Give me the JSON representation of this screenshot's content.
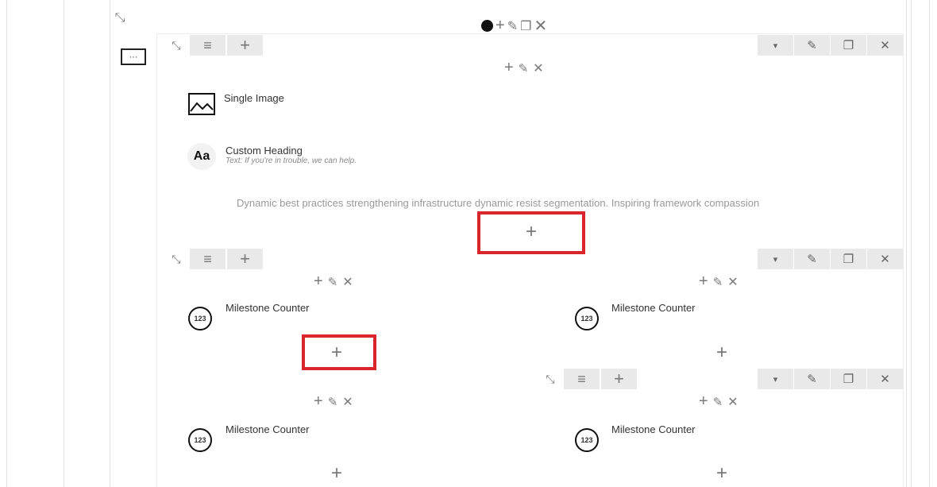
{
  "top_controls": {
    "add": "+",
    "edit": "✎",
    "clone": "❐",
    "delete": "✕"
  },
  "row_ctrl_glyphs": {
    "expand": "⤡",
    "drag": "≡",
    "add": "+",
    "dropdown": "▾",
    "edit": "✎",
    "clone": "❐",
    "delete": "✕"
  },
  "more_button": "···",
  "row1": {
    "column_controls": {
      "add": "+",
      "edit": "✎",
      "delete": "✕"
    },
    "elements": [
      {
        "title": "Single Image",
        "icon": "image-icon"
      },
      {
        "title": "Custom Heading",
        "subtitle": "Text: If you're in trouble, we can help.",
        "icon": "heading-icon",
        "icon_text": "Aa"
      }
    ],
    "text_block": "Dynamic best practices strengthening infrastructure dynamic resist segmentation. Inspiring framework compassion",
    "add_element": "+"
  },
  "inner_row": {
    "left_column": {
      "controls": {
        "add": "+",
        "edit": "✎",
        "delete": "✕"
      },
      "element": {
        "title": "Milestone Counter",
        "icon": "counter-icon",
        "icon_text": "123"
      },
      "add_element": "+"
    },
    "right_column": {
      "controls": {
        "add": "+",
        "edit": "✎",
        "delete": "✕"
      },
      "element": {
        "title": "Milestone Counter",
        "icon": "counter-icon",
        "icon_text": "123"
      },
      "add_element": "+"
    }
  },
  "inner_row_2": {
    "left_column": {
      "controls": {
        "add": "+",
        "edit": "✎",
        "delete": "✕"
      },
      "element": {
        "title": "Milestone Counter",
        "icon": "counter-icon",
        "icon_text": "123"
      },
      "add_element": "+"
    },
    "right_column": {
      "controls": {
        "add": "+",
        "edit": "✎",
        "delete": "✕"
      },
      "element": {
        "title": "Milestone Counter",
        "icon": "counter-icon",
        "icon_text": "123"
      },
      "add_element": "+"
    }
  },
  "colors": {
    "highlight": "#d9262d",
    "toolbar_bg": "#e9e9e9",
    "icon": "#7a7a7a"
  }
}
